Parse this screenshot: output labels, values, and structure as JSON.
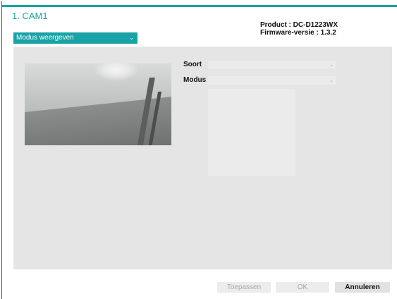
{
  "window": {
    "title": "1. CAM1"
  },
  "device": {
    "product": "Product : DC-D1223WX",
    "firmware": "Firmware-versie : 1.3.2"
  },
  "mode_dropdown": {
    "selected": "Modus weergeven",
    "icon": "chevron-down-icon"
  },
  "settings": {
    "type_label": "Soort",
    "type_value": "",
    "mode_label": "Modus",
    "mode_value": ""
  },
  "buttons": {
    "apply": "Toepassen",
    "ok": "OK",
    "cancel": "Annuleren"
  },
  "colors": {
    "accent": "#19a3a6",
    "panel": "#e5e5e5",
    "disabled_text": "#a8a8a8"
  }
}
